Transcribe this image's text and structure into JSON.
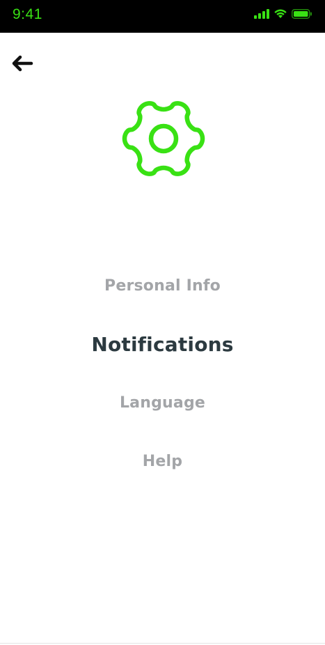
{
  "status_bar": {
    "time": "9:41",
    "accent_color": "#39e114",
    "background_color": "#000000"
  },
  "header": {
    "back_icon": "arrow-left-icon"
  },
  "hero": {
    "icon": "gear-icon",
    "icon_color": "#39e114"
  },
  "menu": {
    "items": [
      {
        "label": "Personal Info",
        "active": false
      },
      {
        "label": "Notifications",
        "active": true
      },
      {
        "label": "Language",
        "active": false
      },
      {
        "label": "Help",
        "active": false
      }
    ],
    "active_color": "#2c3a40",
    "inactive_color": "#a3a5a8"
  }
}
